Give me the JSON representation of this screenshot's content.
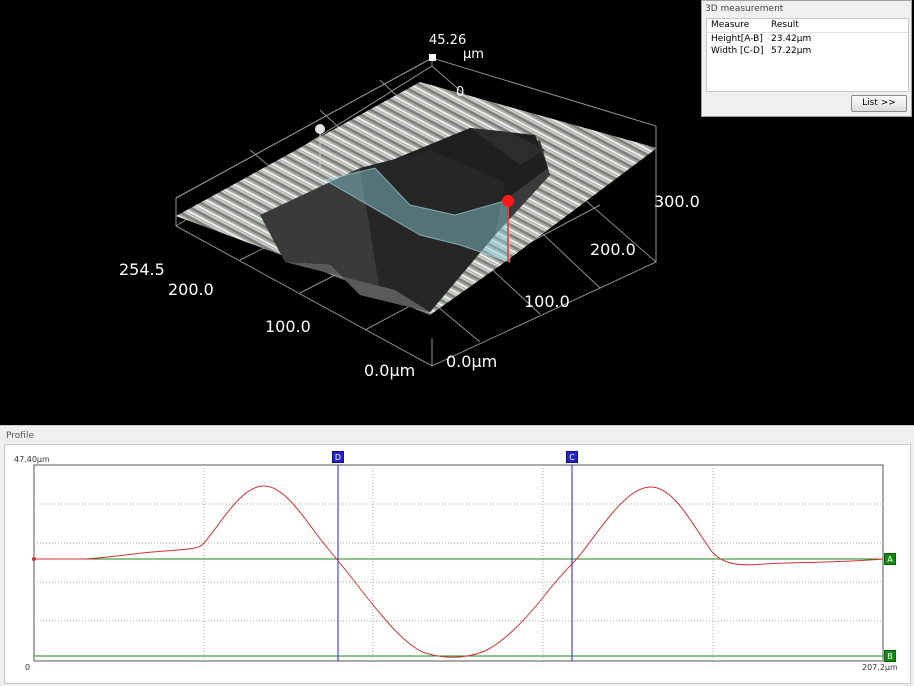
{
  "view3d": {
    "z_max_value": "45.26",
    "z_unit": "μm",
    "z_zero": "0",
    "axis_right": [
      "300.0",
      "200.0",
      "100.0",
      "0.0μm"
    ],
    "axis_left": [
      "254.5",
      "200.0",
      "100.0",
      "0.0μm"
    ]
  },
  "measurement_panel": {
    "title": "3D measurement",
    "col_measure": "Measure",
    "col_result": "Result",
    "rows": [
      {
        "measure": "Height[A-B]",
        "result": "23.42μm"
      },
      {
        "measure": "Width [C-D]",
        "result": "57.22μm"
      }
    ],
    "list_button": "List >>"
  },
  "profile": {
    "title": "Profile",
    "y_max": "47.40μm",
    "x_min": "0",
    "x_max": "207.2μm",
    "markers": {
      "d": "D",
      "c": "C",
      "a": "A",
      "b": "B"
    },
    "colors": {
      "curve": "#cc3333",
      "line_ab": "#1a8a1a",
      "line_cd": "#2323c8"
    }
  }
}
